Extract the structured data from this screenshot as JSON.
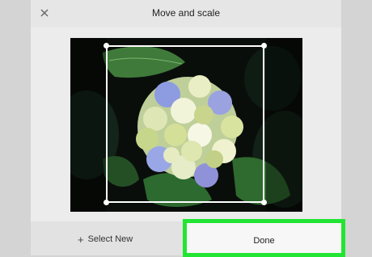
{
  "dialog": {
    "title": "Move and scale",
    "close_icon": "close-icon",
    "image_description_icon": "hydrangea-photo"
  },
  "footer": {
    "select_new_label": "Select New",
    "select_new_icon": "plus-icon",
    "done_label": "Done"
  },
  "colors": {
    "highlight": "#22e533",
    "crop_frame": "#ffffff",
    "dialog_bg": "#ececec"
  }
}
